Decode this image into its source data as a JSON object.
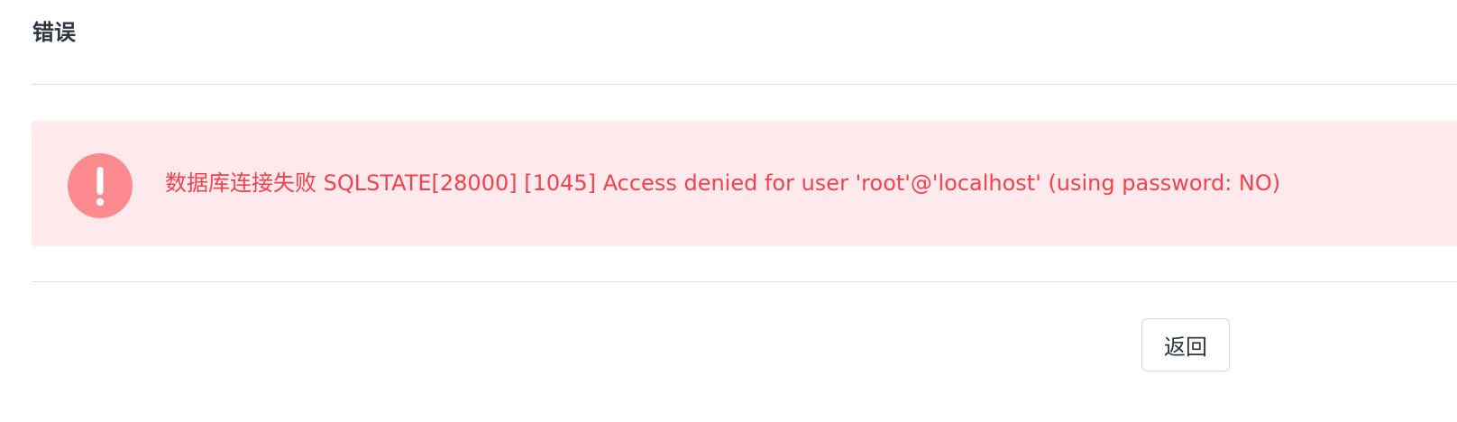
{
  "page": {
    "title": "错误"
  },
  "alert": {
    "type": "error",
    "icon": "exclamation-icon",
    "message": "数据库连接失败 SQLSTATE[28000] [1045] Access denied for user 'root'@'localhost' (using password: NO)",
    "background_color": "#fee9ec",
    "text_color": "#f5414c",
    "icon_color": "#fd8a8e"
  },
  "actions": {
    "back_label": "返回"
  }
}
